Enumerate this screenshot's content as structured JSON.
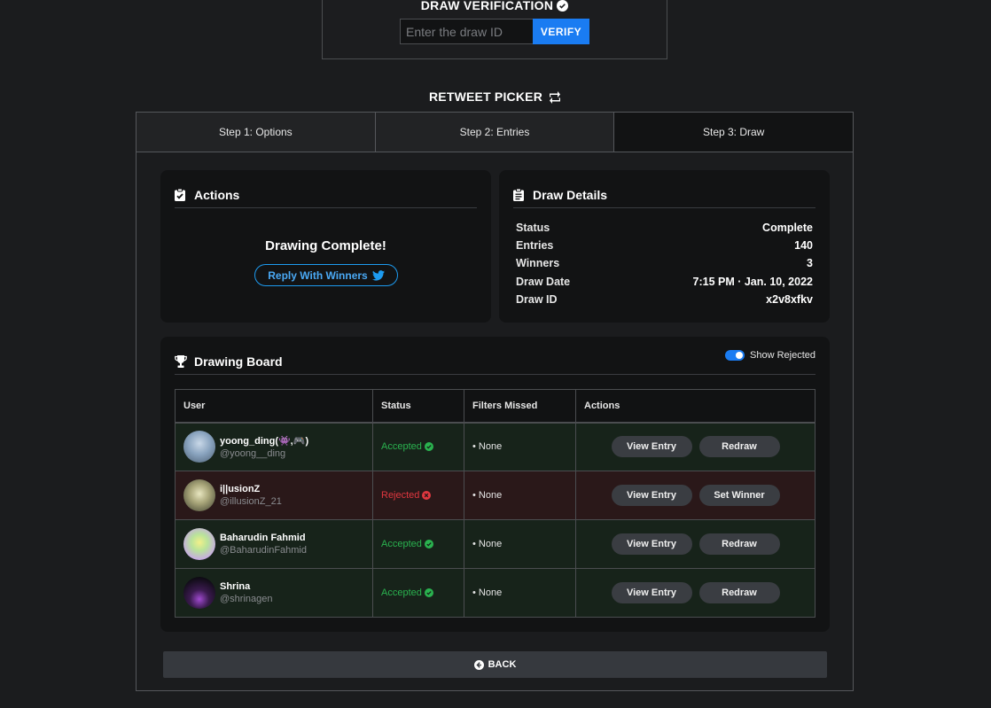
{
  "verification": {
    "title": "DRAW VERIFICATION",
    "input_placeholder": "Enter the draw ID",
    "button_label": "VERIFY"
  },
  "picker": {
    "title": "RETWEET PICKER"
  },
  "steps": [
    {
      "label": "Step 1: Options"
    },
    {
      "label": "Step 2: Entries"
    },
    {
      "label": "Step 3: Draw"
    }
  ],
  "actions_card": {
    "title": "Actions",
    "status_text": "Drawing Complete!",
    "reply_button": "Reply With Winners"
  },
  "details_card": {
    "title": "Draw Details",
    "rows": [
      {
        "label": "Status",
        "value": "Complete"
      },
      {
        "label": "Entries",
        "value": "140"
      },
      {
        "label": "Winners",
        "value": "3"
      },
      {
        "label": "Draw Date",
        "value": "7:15 PM · Jan. 10, 2022"
      },
      {
        "label": "Draw ID",
        "value": "x2v8xfkv"
      }
    ]
  },
  "board": {
    "title": "Drawing Board",
    "toggle_label": "Show Rejected",
    "columns": [
      "User",
      "Status",
      "Filters Missed",
      "Actions"
    ],
    "rows": [
      {
        "name": "yoong_ding(👾,🎮)",
        "handle": "@yoong__ding",
        "status": "Accepted",
        "filters": "• None",
        "action1": "View Entry",
        "action2": "Redraw"
      },
      {
        "name": "i||usionZ",
        "handle": "@illusionZ_21",
        "status": "Rejected",
        "filters": "• None",
        "action1": "View Entry",
        "action2": "Set Winner"
      },
      {
        "name": "Baharudin Fahmid",
        "handle": "@BaharudinFahmid",
        "status": "Accepted",
        "filters": "• None",
        "action1": "View Entry",
        "action2": "Redraw"
      },
      {
        "name": "Shrina",
        "handle": "@shrinagen",
        "status": "Accepted",
        "filters": "• None",
        "action1": "View Entry",
        "action2": "Redraw"
      }
    ]
  },
  "back_button": "BACK",
  "colors": {
    "accent": "#1a7cf2",
    "accepted": "#2ab24f",
    "rejected": "#e0373f",
    "twitter": "#1d9bf0"
  }
}
